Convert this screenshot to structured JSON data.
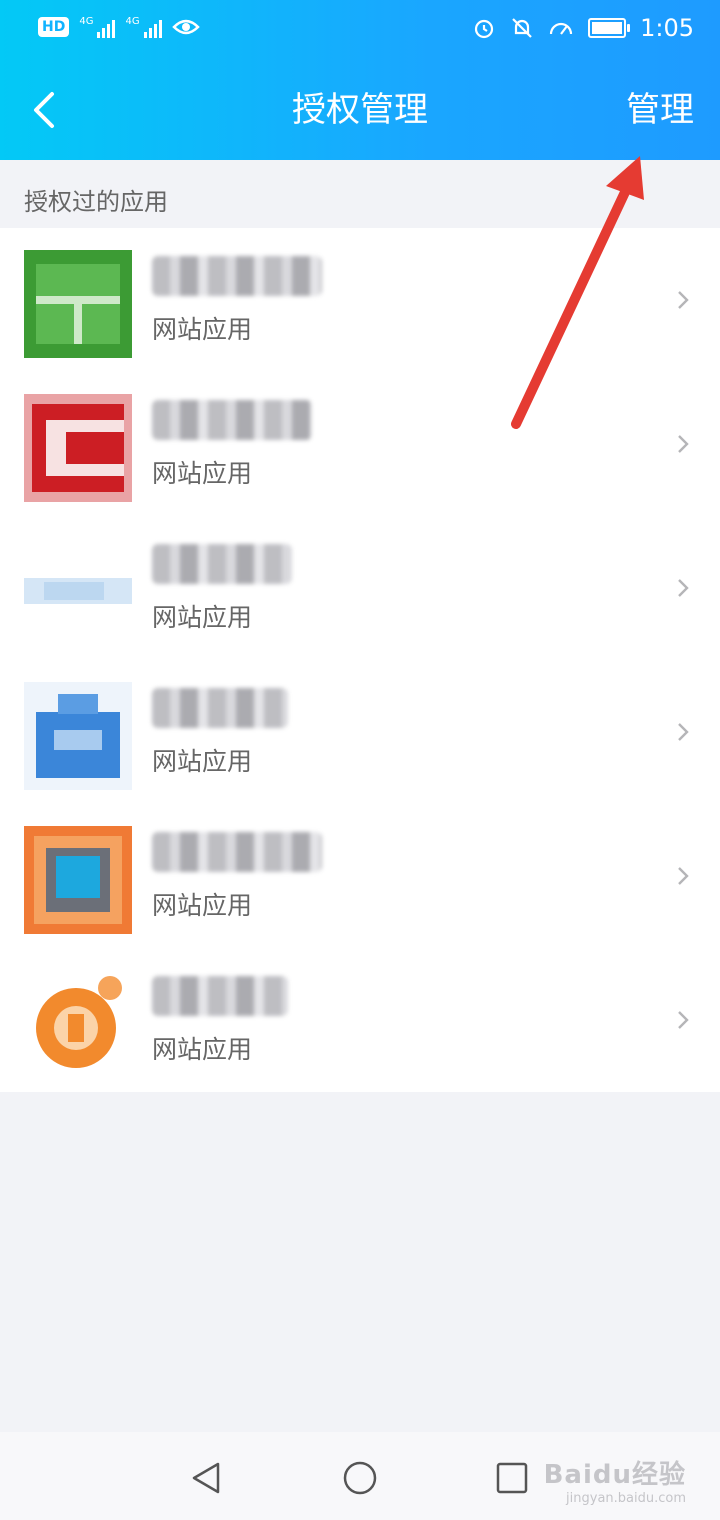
{
  "status_bar": {
    "hd_badge": "HD",
    "network_1": "4G",
    "network_2": "4G",
    "time": "1:05"
  },
  "header": {
    "title": "授权管理",
    "action_label": "管理",
    "background": "#12b4ff"
  },
  "section": {
    "label": "授权过的应用"
  },
  "apps": [
    {
      "subtitle": "网站应用",
      "icon": "green-grid-app-icon",
      "color": "#3c9b34"
    },
    {
      "subtitle": "网站应用",
      "icon": "red-c-app-icon",
      "color": "#cc1e24"
    },
    {
      "subtitle": "网站应用",
      "icon": "light-blue-app-icon",
      "color": "#bcd7f0"
    },
    {
      "subtitle": "网站应用",
      "icon": "blue-house-app-icon",
      "color": "#3b86d9"
    },
    {
      "subtitle": "网站应用",
      "icon": "orange-blue-app-icon",
      "color": "#f07a35"
    },
    {
      "subtitle": "网站应用",
      "icon": "orange-circle-app-icon",
      "color": "#f28a2d"
    }
  ],
  "watermark": {
    "line1": "Baidu经验",
    "line2": "jingyan.baidu.com"
  },
  "annotation": {
    "arrow_color": "#e53b32"
  }
}
